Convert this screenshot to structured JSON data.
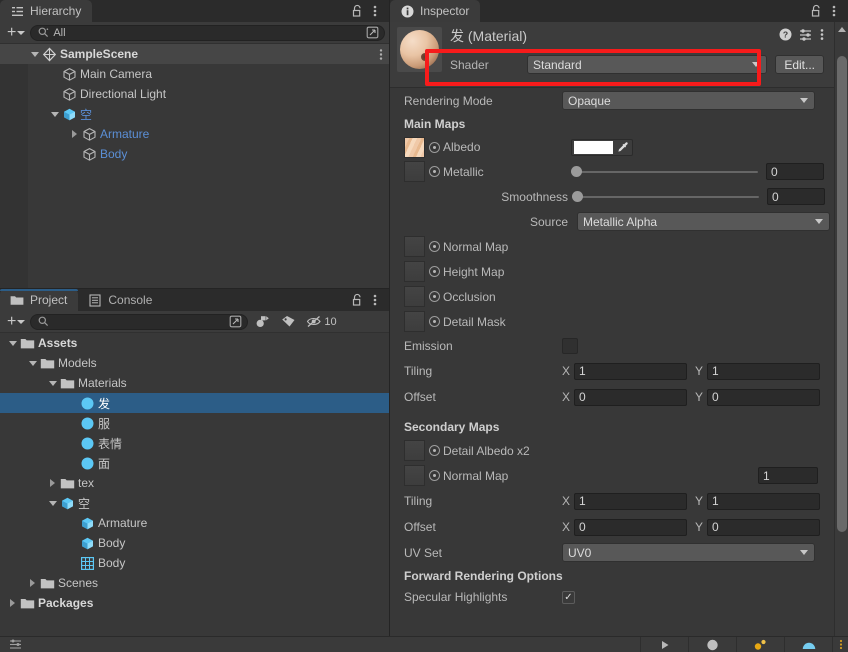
{
  "hierarchy": {
    "tab_label": "Hierarchy",
    "tab_icon": "hierarchy-icon",
    "lock_icon": "lock-open-icon",
    "menu_icon": "kebab-menu-icon",
    "toolbar": {
      "add_label": "+",
      "search_placeholder": "",
      "search_value": "All",
      "search_icon": "search-icon",
      "expand_icon": "expand-search-icon"
    },
    "items": [
      {
        "label": "SampleScene",
        "depth": 0,
        "icon": "unity-scene-icon",
        "twisty": "down",
        "color": "bold",
        "selected_row": true,
        "has_menu": true
      },
      {
        "label": "Main Camera",
        "depth": 1,
        "icon": "gameobject-cube-icon",
        "twisty": "none",
        "color": "normal",
        "selected_row": false,
        "has_menu": false
      },
      {
        "label": "Directional Light",
        "depth": 1,
        "icon": "gameobject-cube-icon",
        "twisty": "none",
        "color": "normal",
        "selected_row": false,
        "has_menu": false
      },
      {
        "label": "空",
        "depth": 1,
        "icon": "prefab-icon",
        "twisty": "down",
        "color": "blue",
        "selected_row": false,
        "has_menu": false
      },
      {
        "label": "Armature",
        "depth": 2,
        "icon": "gameobject-cube-icon",
        "twisty": "right",
        "color": "blue",
        "selected_row": false,
        "has_menu": false
      },
      {
        "label": "Body",
        "depth": 2,
        "icon": "gameobject-cube-icon",
        "twisty": "none",
        "color": "blue",
        "selected_row": false,
        "has_menu": false
      }
    ]
  },
  "project": {
    "tabs": [
      {
        "label": "Project",
        "icon": "folder-icon",
        "active": true
      },
      {
        "label": "Console",
        "icon": "console-icon",
        "active": false
      }
    ],
    "lock_icon": "lock-open-icon",
    "menu_icon": "kebab-menu-icon",
    "toolbar": {
      "add_label": "+",
      "search_placeholder": "",
      "search_value": "",
      "search_icon": "search-icon",
      "expand_icon": "expand-search-icon",
      "filter_icon": "search-by-type-icon",
      "label_icon": "search-by-label-icon",
      "hidden_icon": "hidden-packages-icon",
      "hidden_count": "10"
    },
    "items": [
      {
        "label": "Assets",
        "depth": 0,
        "icon": "folder-icon",
        "twisty": "down",
        "color": "bold",
        "selected": false
      },
      {
        "label": "Models",
        "depth": 1,
        "icon": "folder-icon",
        "twisty": "down",
        "color": "normal",
        "selected": false
      },
      {
        "label": "Materials",
        "depth": 2,
        "icon": "folder-icon",
        "twisty": "down",
        "color": "normal",
        "selected": false
      },
      {
        "label": "发",
        "depth": 3,
        "icon": "material-icon",
        "twisty": "none",
        "color": "normal",
        "selected": true
      },
      {
        "label": "服",
        "depth": 3,
        "icon": "material-icon",
        "twisty": "none",
        "color": "normal",
        "selected": false
      },
      {
        "label": "表情",
        "depth": 3,
        "icon": "material-icon",
        "twisty": "none",
        "color": "normal",
        "selected": false
      },
      {
        "label": "面",
        "depth": 3,
        "icon": "material-icon",
        "twisty": "none",
        "color": "normal",
        "selected": false
      },
      {
        "label": "tex",
        "depth": 2,
        "icon": "folder-icon",
        "twisty": "right",
        "color": "normal",
        "selected": false
      },
      {
        "label": "空",
        "depth": 2,
        "icon": "prefab-icon",
        "twisty": "down",
        "color": "normal",
        "selected": false
      },
      {
        "label": "Armature",
        "depth": 3,
        "icon": "prefab-icon",
        "twisty": "none",
        "color": "normal",
        "selected": false
      },
      {
        "label": "Body",
        "depth": 3,
        "icon": "prefab-icon",
        "twisty": "none",
        "color": "normal",
        "selected": false
      },
      {
        "label": "Body",
        "depth": 3,
        "icon": "mesh-icon",
        "twisty": "none",
        "color": "normal",
        "selected": false
      },
      {
        "label": "Scenes",
        "depth": 1,
        "icon": "folder-icon",
        "twisty": "right",
        "color": "normal",
        "selected": false
      },
      {
        "label": "Packages",
        "depth": 0,
        "icon": "folder-icon",
        "twisty": "right",
        "color": "bold",
        "selected": false
      }
    ]
  },
  "inspector": {
    "tab_label": "Inspector",
    "tab_icon": "info-icon",
    "lock_icon": "lock-open-icon",
    "menu_icon": "kebab-menu-icon",
    "material": {
      "title": "发 (Material)",
      "preview_icon": "material-sphere-preview",
      "help_icon": "help-icon",
      "preset_icon": "preset-icon",
      "kebab_icon": "kebab-menu-icon",
      "shader_label": "Shader",
      "shader_value": "Standard",
      "edit_label": "Edit...",
      "highlight_color": "#f71b1b"
    },
    "rendering_mode": {
      "label": "Rendering Mode",
      "value": "Opaque"
    },
    "main_maps": {
      "header": "Main Maps",
      "albedo": {
        "label": "Albedo",
        "color_value": "#ffffff",
        "eyedropper_icon": "eyedropper-icon",
        "has_texture": true
      },
      "metallic": {
        "label": "Metallic",
        "value": "0",
        "slider_pct": 0
      },
      "smoothness": {
        "label": "Smoothness",
        "value": "0",
        "slider_pct": 0
      },
      "source": {
        "label": "Source",
        "value": "Metallic Alpha"
      },
      "normal_map": {
        "label": "Normal Map"
      },
      "height_map": {
        "label": "Height Map"
      },
      "occlusion": {
        "label": "Occlusion"
      },
      "detail_mask": {
        "label": "Detail Mask"
      },
      "emission": {
        "label": "Emission",
        "checked": false
      },
      "tiling": {
        "label": "Tiling",
        "x_axis": "X",
        "x": "1",
        "y_axis": "Y",
        "y": "1"
      },
      "offset": {
        "label": "Offset",
        "x_axis": "X",
        "x": "0",
        "y_axis": "Y",
        "y": "0"
      }
    },
    "secondary_maps": {
      "header": "Secondary Maps",
      "detail_albedo": {
        "label": "Detail Albedo x2"
      },
      "normal_map": {
        "label": "Normal Map",
        "value": "1"
      },
      "tiling": {
        "label": "Tiling",
        "x_axis": "X",
        "x": "1",
        "y_axis": "Y",
        "y": "1"
      },
      "offset": {
        "label": "Offset",
        "x_axis": "X",
        "x": "0",
        "y_axis": "Y",
        "y": "0"
      },
      "uv_set": {
        "label": "UV Set",
        "value": "UV0"
      }
    },
    "forward_rendering": {
      "header": "Forward Rendering Options",
      "specular_highlights": {
        "label": "Specular Highlights",
        "checked": true
      }
    },
    "scrollbar": {
      "up_icon": "scroll-up-arrow",
      "down_icon": "scroll-down-arrow"
    }
  },
  "footer": {
    "left_icon": "preview-settings-icon",
    "cells": [
      {
        "icon": "play-preview-icon"
      },
      {
        "icon": "sphere-preview-icon"
      },
      {
        "icon": "lighting-preview-icon"
      },
      {
        "icon": "skybox-preview-icon"
      },
      {
        "icon": "more-preview-icon"
      }
    ]
  }
}
